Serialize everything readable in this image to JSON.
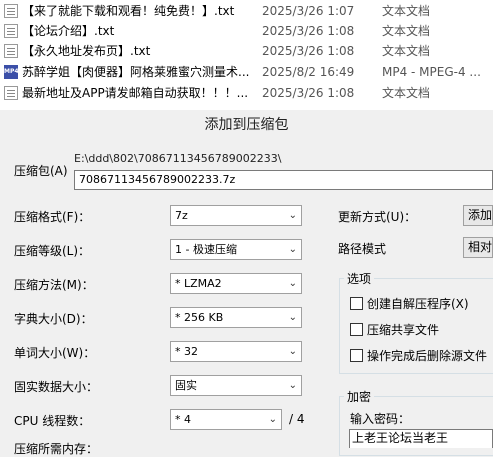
{
  "files": [
    {
      "name": "【来了就能下载和观看！纯免费！】.txt",
      "date": "2025/3/26 1:07",
      "type": "文本文档",
      "icon": "text-file-icon"
    },
    {
      "name": "【论坛介绍】.txt",
      "date": "2025/3/26 1:08",
      "type": "文本文档",
      "icon": "text-file-icon"
    },
    {
      "name": "【永久地址发布页】.txt",
      "date": "2025/3/26 1:08",
      "type": "文本文档",
      "icon": "text-file-icon"
    },
    {
      "name": "苏醉学姐【肉便器】阿格莱雅蜜穴测量术...",
      "date": "2025/8/2 16:49",
      "type": "MP4 - MPEG-4 ...",
      "icon": "mp4-file-icon",
      "icon_text": "MP4"
    },
    {
      "name": "最新地址及APP请发邮箱自动获取！！！...",
      "date": "2025/3/26 1:08",
      "type": "文本文档",
      "icon": "text-file-icon"
    }
  ],
  "dialog": {
    "title": "添加到压缩包",
    "archive_label": "压缩包(A)",
    "archive_path": "E:\\ddd\\802\\70867113456789002233\\",
    "archive_name": "70867113456789002233.7z",
    "format": {
      "label": "压缩格式(F)：",
      "value": "7z"
    },
    "level": {
      "label": "压缩等级(L)：",
      "value": "1 - 极速压缩"
    },
    "method": {
      "label": "压缩方法(M)：",
      "value": "* LZMA2"
    },
    "dict": {
      "label": "字典大小(D)：",
      "value": "* 256 KB"
    },
    "word": {
      "label": "单词大小(W)：",
      "value": "* 32"
    },
    "solid": {
      "label": "固实数据大小：",
      "value": "固实"
    },
    "cpu": {
      "label": "CPU 线程数：",
      "value": "* 4",
      "max": "/ 4"
    },
    "mem": {
      "label": "压缩所需内存："
    },
    "update": {
      "label": "更新方式(U)：",
      "value": "添加"
    },
    "pathmode": {
      "label": "路径模式",
      "value": "相对"
    },
    "options": {
      "legend": "选项",
      "sfx": "创建自解压程序(X)",
      "shared": "压缩共享文件",
      "delete": "操作完成后删除源文件"
    },
    "encrypt": {
      "legend": "加密",
      "pwd_label": "输入密码：",
      "pwd_value": "上老王论坛当老王"
    },
    "arrow_glyph": "⌄"
  }
}
